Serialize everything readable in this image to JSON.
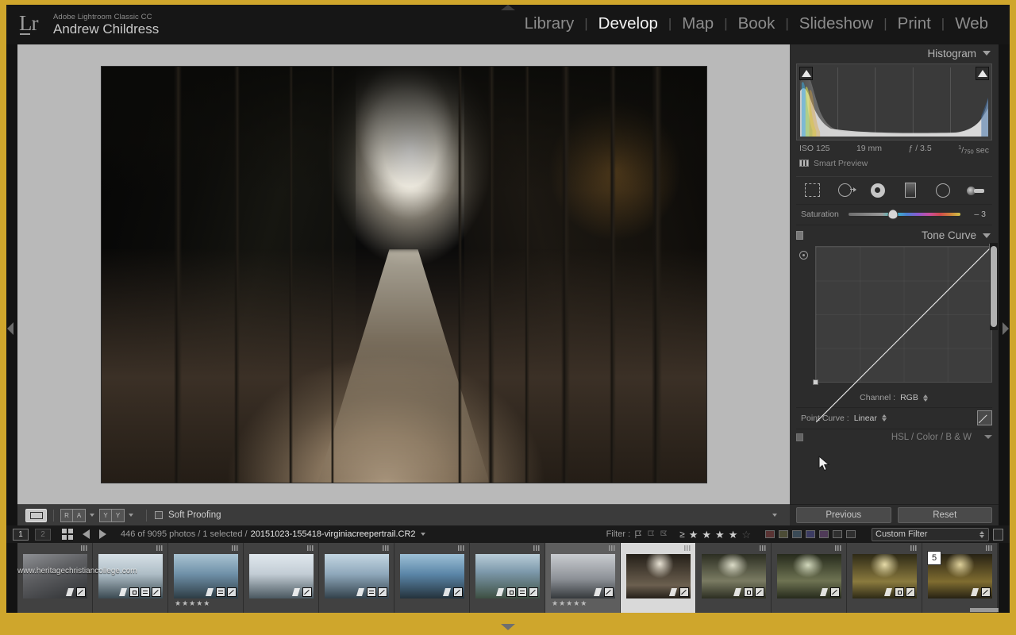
{
  "app": {
    "name": "Adobe Lightroom Classic CC",
    "user": "Andrew Childress",
    "logo_text": "Lr"
  },
  "modules": {
    "items": [
      {
        "label": "Library",
        "active": false
      },
      {
        "label": "Develop",
        "active": true
      },
      {
        "label": "Map",
        "active": false
      },
      {
        "label": "Book",
        "active": false
      },
      {
        "label": "Slideshow",
        "active": false
      },
      {
        "label": "Print",
        "active": false
      },
      {
        "label": "Web",
        "active": false
      }
    ],
    "separator": "|"
  },
  "histogram": {
    "title": "Histogram",
    "exif": {
      "iso": "ISO 125",
      "focal": "19 mm",
      "aperture": "ƒ / 3.5",
      "shutter_num": "1",
      "shutter_den": "750",
      "shutter_unit": "sec"
    },
    "smart_preview": "Smart Preview"
  },
  "tools": {
    "items": [
      {
        "name": "crop-overlay-tool"
      },
      {
        "name": "spot-removal-tool"
      },
      {
        "name": "red-eye-tool"
      },
      {
        "name": "graduated-filter-tool"
      },
      {
        "name": "radial-filter-tool"
      },
      {
        "name": "adjustment-brush-tool"
      }
    ]
  },
  "saturation": {
    "label": "Saturation",
    "value": "– 3",
    "knob_percent": 40
  },
  "tone_curve": {
    "title": "Tone Curve",
    "channel_label": "Channel :",
    "channel_value": "RGB",
    "point_curve_label": "Point Curve :",
    "point_curve_value": "Linear"
  },
  "hsl_panel": {
    "title": "HSL / Color / B & W"
  },
  "panel_buttons": {
    "previous": "Previous",
    "reset": "Reset"
  },
  "toolbar": {
    "view_loupe": "loupe-view",
    "before_after_r": "R",
    "before_after_a": "A",
    "split_y1": "Y",
    "split_y2": "Y",
    "soft_proofing": "Soft Proofing"
  },
  "filmstrip_bar": {
    "source1": "1",
    "source2": "2",
    "count_text": "446 of 9095 photos / 1 selected /",
    "filename": "20151023-155418-virginiacreepertrail.CR2",
    "filter_label": "Filter :",
    "rating_operator": "≥",
    "stars_filled": 4,
    "stars_total": 5,
    "color_swatches": [
      "#5a3434",
      "#4c4c36",
      "#3a4a56",
      "#3c3c62",
      "#4f3a58",
      "#3f3f3f",
      "#3f3f3f"
    ],
    "custom_filter": "Custom Filter"
  },
  "watermark": "www.heritagechristiancollege.com",
  "filmstrip": {
    "thumbnails": [
      {
        "name": "thumb-1",
        "state": "normal",
        "stars": "",
        "stack": "",
        "badges": [
          "rot",
          "edit"
        ],
        "c1": "#5f6063",
        "c2": "#2e3033",
        "c3": "#8e9094",
        "style": "rocky-bw"
      },
      {
        "name": "thumb-2",
        "state": "normal",
        "stars": "",
        "stack": "",
        "badges": [
          "rot",
          "crop",
          "meta",
          "edit"
        ],
        "c1": "#aebdc6",
        "c2": "#3b4a52",
        "c3": "#d6e0e6",
        "style": "seascape"
      },
      {
        "name": "thumb-3",
        "state": "normal",
        "stars": "★★★★★",
        "stack": "",
        "badges": [
          "rot",
          "meta",
          "edit"
        ],
        "c1": "#6f90a8",
        "c2": "#2d3c44",
        "c3": "#a9c3d2",
        "style": "seascape"
      },
      {
        "name": "thumb-4",
        "state": "normal",
        "stars": "",
        "stack": "",
        "badges": [
          "rot",
          "edit"
        ],
        "c1": "#c2ccd4",
        "c2": "#4a5860",
        "c3": "#e0e8ee",
        "style": "seascape"
      },
      {
        "name": "thumb-5",
        "state": "normal",
        "stars": "",
        "stack": "",
        "badges": [
          "rot",
          "meta",
          "edit"
        ],
        "c1": "#8fa8bb",
        "c2": "#32414b",
        "c3": "#c3d6e2",
        "style": "seascape"
      },
      {
        "name": "thumb-6",
        "state": "normal",
        "stars": "",
        "stack": "",
        "badges": [
          "rot",
          "edit"
        ],
        "c1": "#5b86a8",
        "c2": "#24323c",
        "c3": "#9dc0d6",
        "style": "seascape"
      },
      {
        "name": "thumb-7",
        "state": "normal",
        "stars": "",
        "stack": "",
        "badges": [
          "rot",
          "crop",
          "meta",
          "edit"
        ],
        "c1": "#7d99ab",
        "c2": "#3d4f42",
        "c3": "#b9cdd8",
        "style": "coastal"
      },
      {
        "name": "thumb-8",
        "state": "active",
        "stars": "★★★★★",
        "stack": "",
        "badges": [
          "rot",
          "edit"
        ],
        "c1": "#8e9298",
        "c2": "#35393c",
        "c3": "#c9ccd0",
        "style": "moody"
      },
      {
        "name": "thumb-9",
        "state": "selected",
        "stars": "",
        "stack": "",
        "badges": [
          "rot",
          "edit"
        ],
        "c1": "#6b5f4f",
        "c2": "#241f18",
        "c3": "#e8e2d4",
        "style": "forest-path"
      },
      {
        "name": "thumb-10",
        "state": "normal",
        "stars": "",
        "stack": "",
        "badges": [
          "rot",
          "crop",
          "edit"
        ],
        "c1": "#7a7b62",
        "c2": "#2c2e22",
        "c3": "#dcdcc8",
        "style": "forest-stream"
      },
      {
        "name": "thumb-11",
        "state": "normal",
        "stars": "",
        "stack": "",
        "badges": [
          "rot",
          "edit"
        ],
        "c1": "#6e7352",
        "c2": "#262a1c",
        "c3": "#d2d8bc",
        "style": "forest-stream"
      },
      {
        "name": "thumb-12",
        "state": "normal",
        "stars": "",
        "stack": "",
        "badges": [
          "rot",
          "crop",
          "edit"
        ],
        "c1": "#8a7a3e",
        "c2": "#2e2a16",
        "c3": "#e6dba8",
        "style": "autumn-stream"
      },
      {
        "name": "thumb-13",
        "state": "normal",
        "stars": "",
        "stack": "5",
        "badges": [
          "rot",
          "edit"
        ],
        "c1": "#7f6c30",
        "c2": "#272214",
        "c3": "#ded09a",
        "style": "autumn-stream"
      }
    ]
  }
}
